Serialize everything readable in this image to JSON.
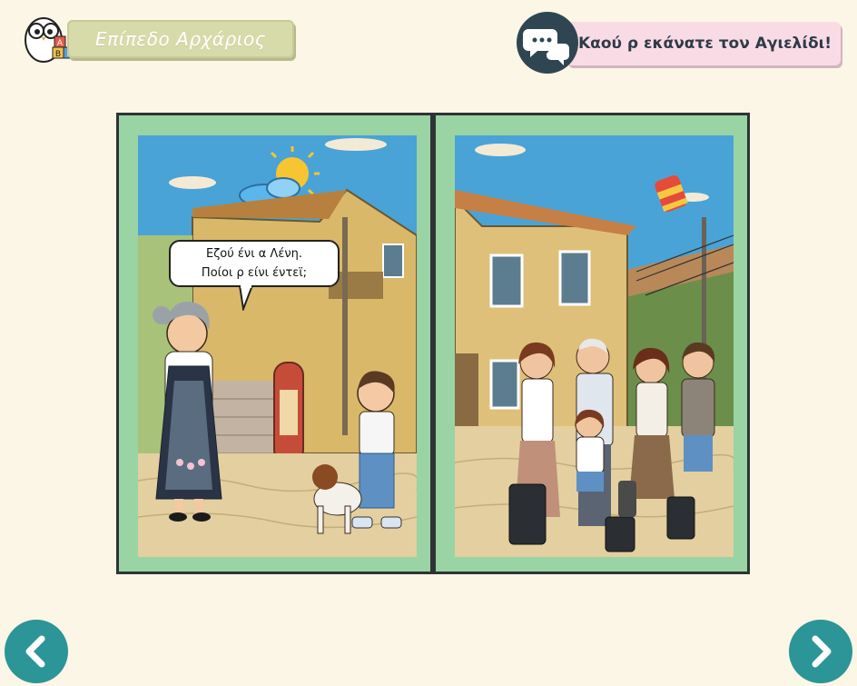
{
  "header": {
    "level_label": "Επίπεδο Αρχάριος",
    "owl_icon": "owl-abc-blocks-icon",
    "owl_blocks": [
      "Α",
      "Β",
      "Γ"
    ]
  },
  "instruction": {
    "text": "Καού ρ εκάνατε τον Αγιελίδι!",
    "icon": "chat-bubbles-icon"
  },
  "story": {
    "speech_line1": "Εζού ένι α Λένη.",
    "speech_line2": "Ποίοι ρ είνι έντεϊ;"
  },
  "navigation": {
    "prev_icon": "chevron-left-icon",
    "next_icon": "chevron-right-icon"
  },
  "colors": {
    "background": "#fbf6e6",
    "level_pill": "#d7dba9",
    "instruction_pill": "#f9dbe6",
    "nav_button": "#2c9597",
    "page_border": "#9ad3a4"
  }
}
